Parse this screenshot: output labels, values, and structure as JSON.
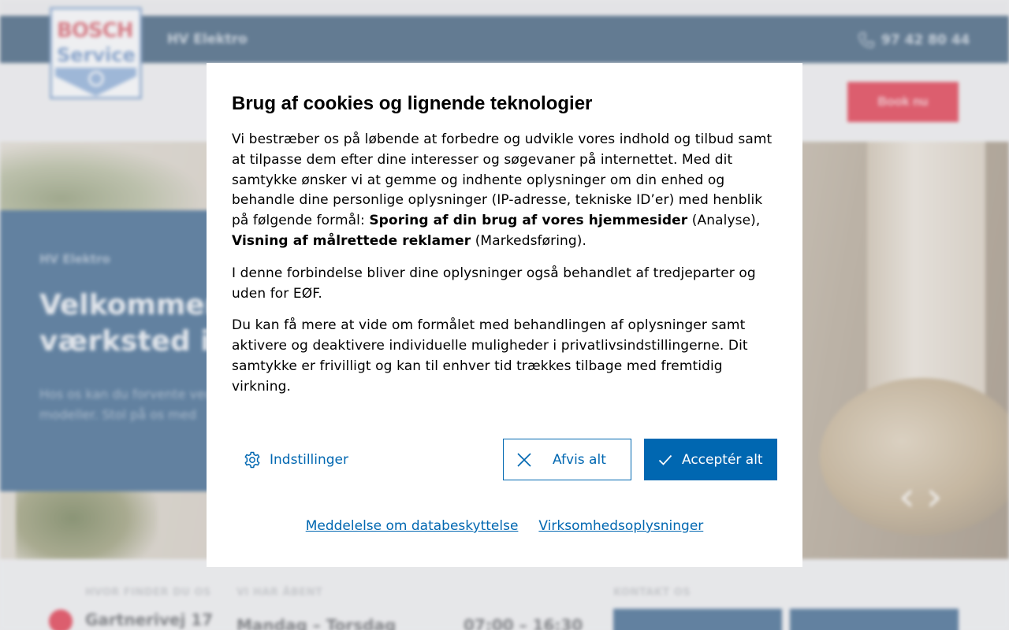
{
  "background": {
    "brand_name": "HV Elektro",
    "phone": "97 42 80 44",
    "book_button": "Book nu",
    "logo_line1": "BOSCH",
    "logo_line2": "Service",
    "hero_small": "HV Elektro",
    "hero_title": "Velkommen til dit værksted i H",
    "hero_text": "Hos os kan du forvente vedligeholdelse og repar modeller. Stol på os med",
    "footer": {
      "label_address": "HVOR FINDER DU OS",
      "address": "Gartnerivej 17",
      "label_hours": "VI HAR ÅBENT",
      "days": "Mandag – Torsdag",
      "hours": "07:00 – 16:30",
      "label_contact": "KONTAKT OS"
    }
  },
  "modal": {
    "title": "Brug af cookies og lignende teknologier",
    "p1_text": "Vi bestræber os på løbende at forbedre og udvikle vores indhold og tilbud samt at tilpasse dem efter dine interesser og søgevaner på internettet. Med dit samtykke ønsker vi at gemme og indhente oplysninger om din enhed og behandle dine personlige oplysninger (IP-adresse, tekniske ID’er) med henblik på følgende formål: ",
    "p1_bold1": "Sporing af din brug af vores hjemmesider",
    "p1_mid": " (Analyse), ",
    "p1_bold2": "Visning af målrettede reklamer",
    "p1_end": " (Markedsføring).",
    "p2": "I denne forbindelse bliver dine oplysninger også behandlet af tredjeparter og uden for EØF.",
    "p3": "Du kan få mere at vide om formålet med behandlingen af oplysninger samt aktivere og deaktivere individuelle muligheder i privatlivsindstillingerne. Dit samtykke er frivilligt og kan til enhver tid trækkes tilbage med fremtidig virkning.",
    "settings_label": "Indstillinger",
    "reject_label": "Afvis alt",
    "accept_label": "Acceptér alt",
    "link_privacy": "Meddelelse om databeskyttelse",
    "link_company": "Virksomhedsoplysninger",
    "icons": {
      "settings": "gear-icon",
      "reject": "close-icon",
      "accept": "checkmark-icon"
    },
    "colors": {
      "accent": "#0067b1",
      "book": "#d9182f",
      "header": "#1f4466"
    }
  }
}
